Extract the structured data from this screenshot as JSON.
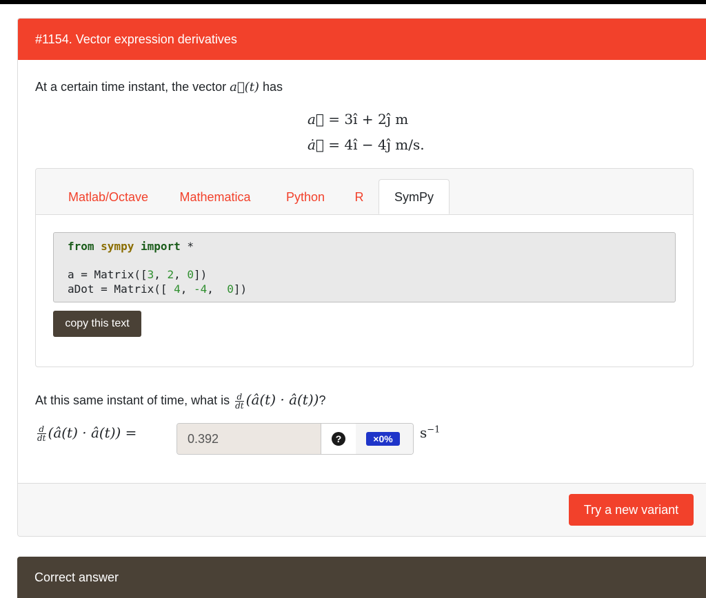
{
  "problem": {
    "title": "#1154. Vector expression derivatives",
    "intro_prefix": "At a certain time instant, the vector ",
    "intro_suffix": " has",
    "eq1_lhs": "a⃗ = ",
    "eq1_rhs": "3î + 2ĵ m",
    "eq2_lhs": "ȧ⃗ = ",
    "eq2_rhs": "4î − 4ĵ m/s."
  },
  "tabs": {
    "matlab": "Matlab/Octave",
    "mathematica": "Mathematica",
    "python": "Python",
    "r": "R",
    "sympy": "SymPy"
  },
  "code": {
    "line1_kw1": "from",
    "line1_mod": " sympy ",
    "line1_kw2": "import",
    "line1_rest": " *",
    "line2_a": "a = Matrix([",
    "line2_n1": "3",
    "line2_sep1": ", ",
    "line2_n2": "2",
    "line2_sep2": ", ",
    "line2_n3": "0",
    "line2_end": "])",
    "line3_a": "aDot = Matrix([ ",
    "line3_n1": "4",
    "line3_sep1": ", ",
    "line3_n2": "-4",
    "line3_sep2": ",  ",
    "line3_n3": "0",
    "line3_end": "])"
  },
  "copy_button": "copy this text",
  "question": {
    "prefix": "At this same instant of time, what is ",
    "expr": "(â(t) · â(t))",
    "suffix": "?",
    "frac_num": "d",
    "frac_den": "dt"
  },
  "answer": {
    "expr": "(â(t) · â(t)) =",
    "value": "0.392",
    "help_icon": "?",
    "score": "×0%",
    "unit_base": "s",
    "unit_exp": "−1"
  },
  "footer": {
    "variant_button": "Try a new variant"
  },
  "next_card": {
    "title": "Correct answer"
  },
  "colors": {
    "header_red": "#f2412b",
    "dark_brown": "#4a4136",
    "score_blue": "#1f35c9"
  }
}
